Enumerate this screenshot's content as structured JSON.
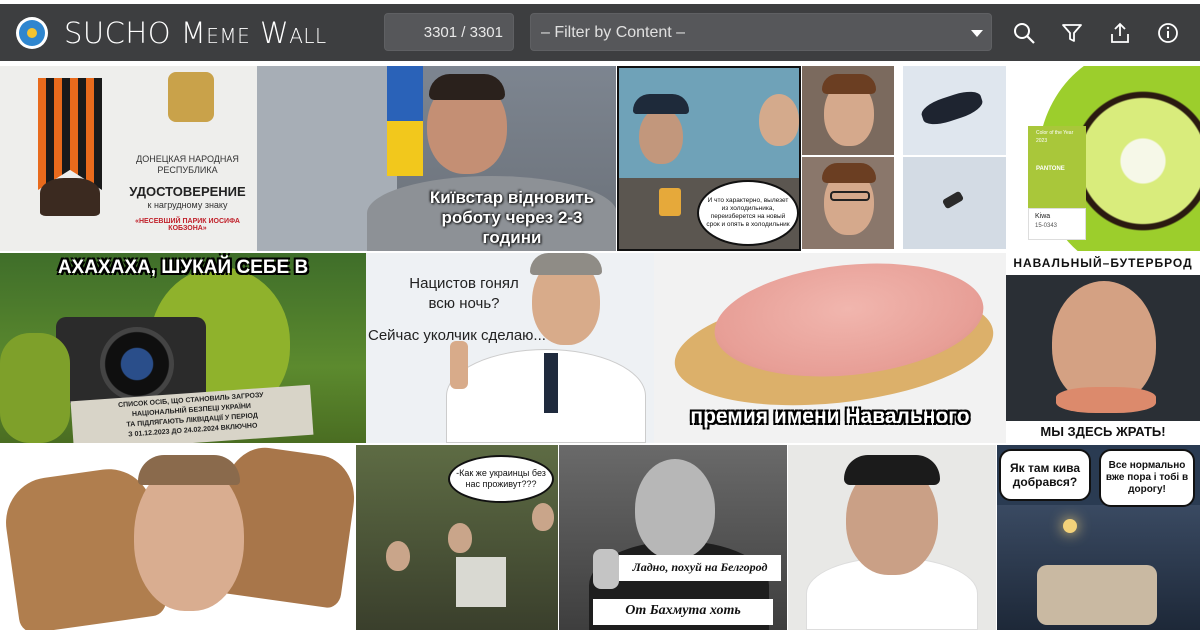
{
  "header": {
    "title_sucho": "SUCHO",
    "title_meme": "Meme",
    "title_wall": "Wall",
    "counter": "3301 / 3301",
    "filter_placeholder": "– Filter by Content –",
    "icons": [
      "search-icon",
      "filter-icon",
      "share-icon",
      "info-icon"
    ]
  },
  "colors": {
    "header_bg": "#3d3e40",
    "control_bg": "#56575a",
    "logo_blue": "#2f86cf",
    "logo_yellow": "#f4c430"
  },
  "memes": {
    "medal": {
      "line1": "ДОНЕЦКАЯ НАРОДНАЯ",
      "line2": "РЕСПУБЛИКА",
      "line3": "УДОСТОВЕРЕНИЕ",
      "line4": "к нагрудному знаку",
      "line5": "«НЕСЕВШИЙ ПАРИК ИОСИФА КОБЗОНА»"
    },
    "arestovich": {
      "line1": "Київстар відновить",
      "line2": "роботу через 2-3",
      "line3": "години"
    },
    "fisherman": {
      "bubble": "И что характерно, вылезет из холодильника, переизберется на новый срок и опять в холодильник"
    },
    "kiwi": {
      "line1": "Color of the Year",
      "line2": "2023",
      "brand": "PANTONE",
      "name": "Kiwa",
      "code": "15-0343"
    },
    "shrek": {
      "top": "АХАХАХА, ШУКАЙ СЕБЕ В",
      "doc1": "СПИСОК ОСІБ, ЩО СТАНОВИЛЬ ЗАГРОЗУ",
      "doc2": "НАЦІОНАЛЬНІЙ БЕЗПЕЦІ УКРАЇНИ",
      "doc3": "ТА ПІДЛЯГАЮТЬ ЛІКВІДАЦІЇ У ПЕРІОД",
      "doc4": "З 01.12.2023 ДО 24.02.2024 ВКЛЮЧНО"
    },
    "doctor": {
      "line1": "Нацистов гонял",
      "line2": "всю ночь?",
      "line3": "Сейчас уколчик сделаю..."
    },
    "sandwich": {
      "caption": "премия имени Навального"
    },
    "navalny_bread": {
      "top": "НАВАЛЬНЫЙ–БУТЕРБРОД",
      "bottom": "МЫ ЗДЕСЬ ЖРАТЬ!"
    },
    "kitchen": {
      "bubble": "-Как же украинцы без нас проживут???"
    },
    "putin": {
      "line1": "Ладно, похуй на Белгород",
      "line2": "От Бахмута хоть"
    },
    "bedroom": {
      "bubble1": "Як там кива добрався?",
      "bubble2": "Все нормально вже пора і тобі в дорогу!"
    }
  }
}
